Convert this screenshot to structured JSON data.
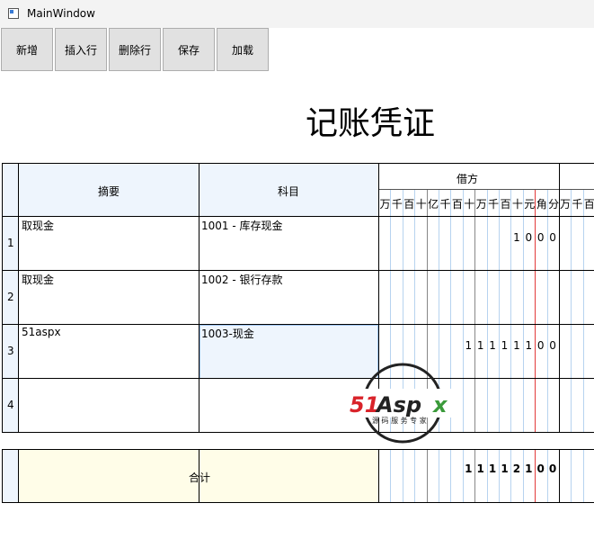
{
  "window": {
    "title": "MainWindow"
  },
  "toolbar": {
    "buttons": [
      "新增",
      "插入行",
      "删除行",
      "保存",
      "加载"
    ]
  },
  "document": {
    "title": "记账凭证"
  },
  "table": {
    "header": {
      "summary": "摘要",
      "account": "科目",
      "debit": "借方",
      "debit_units": [
        "万",
        "千",
        "百",
        "十",
        "亿",
        "千",
        "百",
        "十",
        "万",
        "千",
        "百",
        "十",
        "元",
        "角",
        "分"
      ],
      "credit_units": [
        "万",
        "千",
        "百"
      ]
    },
    "rows": [
      {
        "no": "1",
        "summary": "取现金",
        "account": "1001 - 库存现金",
        "debit": [
          "1",
          "0",
          "0",
          "0"
        ]
      },
      {
        "no": "2",
        "summary": "取现金",
        "account": "1002 - 银行存款",
        "debit": []
      },
      {
        "no": "3",
        "summary": "51aspx",
        "account": "1003-现金",
        "debit": [
          "1",
          "1",
          "1",
          "1",
          "1",
          "1",
          "0",
          "0"
        ]
      },
      {
        "no": "4",
        "summary": "",
        "account": "",
        "debit": []
      }
    ],
    "total": {
      "label": "合计",
      "debit": [
        "1",
        "1",
        "1",
        "1",
        "2",
        "1",
        "0",
        "0"
      ]
    }
  },
  "watermark": {
    "brand": "51Aspx",
    "tagline": "源码服务专家",
    "colors": {
      "red": "#d9232a",
      "green": "#3a9a3a",
      "dark": "#222222"
    }
  }
}
